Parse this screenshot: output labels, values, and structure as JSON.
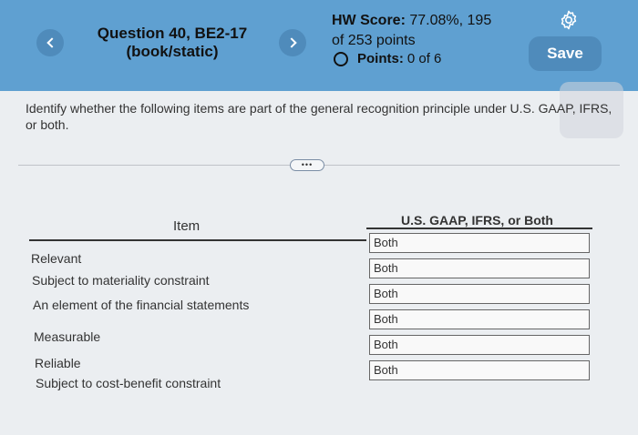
{
  "header": {
    "title_line1": "Question 40, BE2-17",
    "title_line2": "(book/static)",
    "hw_score_label": "HW Score:",
    "hw_score_value": "77.08%, 195",
    "hw_score_line2": "of 253 points",
    "points_label": "Points:",
    "points_value": "0 of 6",
    "save_label": "Save"
  },
  "question": {
    "prompt": "Identify whether the following items are part of the general recognition principle under U.S. GAAP, IFRS, or both.",
    "more_label": "•••"
  },
  "table": {
    "col_item": "Item",
    "col_answer": "U.S. GAAP, IFRS, or Both",
    "rows": [
      {
        "item": "Relevant",
        "answer": "Both"
      },
      {
        "item": "Subject to materiality constraint",
        "answer": "Both"
      },
      {
        "item": "An element of the financial statements",
        "answer": "Both"
      },
      {
        "item": "Measurable",
        "answer": "Both"
      },
      {
        "item": "Reliable",
        "answer": "Both"
      },
      {
        "item": "Subject to cost-benefit constraint",
        "answer": "Both"
      }
    ]
  },
  "colors": {
    "header_bg": "#5fa0d1",
    "button_bg": "#4f8bbb"
  }
}
